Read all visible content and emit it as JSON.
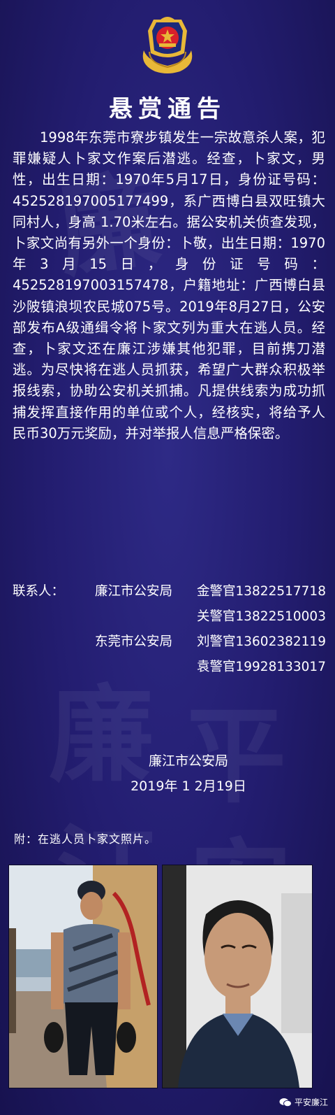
{
  "notice": {
    "title": "悬赏通告",
    "paragraph": "1998年东莞市寮步镇发生一宗故意杀人案，犯罪嫌疑人卜家文作案后潜逃。经查，卜家文，男性，出生日期：1970年5月17日，身份证号码：452528197005177499，系广西博白县双旺镇大同村人，身高 1.70米左右。据公安机关侦查发现，卜家文尚有另外一个身份：卜敬，出生日期：1970年3月15日，身份证号码：452528197003157478，户籍地址：广西博白县沙陂镇浪坝农民城075号。2019年8月27日，公安部发布A级通缉令将卜家文列为重大在逃人员。经查，卜家文还在廉江涉嫌其他犯罪，目前携刀潜逃。为尽快将在逃人员抓获，希望广大群众积极举报线索，协助公安机关抓捕。凡提供线索为成功抓捕发挥直接作用的单位或个人，经核实，将给予人民币30万元奖励，并对举报人信息严格保密。"
  },
  "contacts": {
    "label": "联系人：",
    "rows": [
      {
        "org": "廉江市公安局",
        "officer": "金警官13822517718"
      },
      {
        "org": "",
        "officer": "关警官13822510003"
      },
      {
        "org": "东莞市公安局",
        "officer": "刘警官13602382119"
      },
      {
        "org": "",
        "officer": "袁警官19928133017"
      }
    ]
  },
  "signoff": {
    "issuer": "廉江市公安局",
    "date": "2019年 1 2月19日"
  },
  "attachment_caption": "附：在逃人员卜家文照片。",
  "footer": {
    "account_name": "平安廉江"
  },
  "watermark": {
    "characters": [
      "廉",
      "廉",
      "平",
      "江",
      "安"
    ]
  },
  "colors": {
    "background": "#231d70",
    "emblem_red": "#d8202a",
    "emblem_gold": "#e8b838"
  }
}
